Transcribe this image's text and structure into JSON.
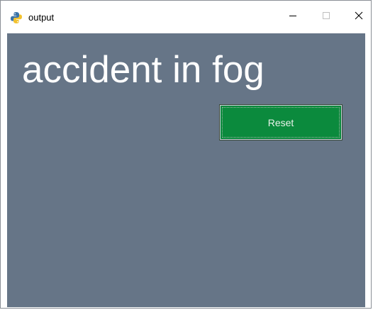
{
  "window": {
    "title": "output",
    "app_icon": "python-icon",
    "controls": {
      "minimize_icon": "minimize-icon",
      "maximize_icon": "maximize-icon",
      "close_icon": "close-icon"
    }
  },
  "content": {
    "headline": "accident in fog",
    "reset_label": "Reset"
  },
  "colors": {
    "content_bg": "#667587",
    "button_bg": "#0b8a3d",
    "text": "#ffffff"
  }
}
